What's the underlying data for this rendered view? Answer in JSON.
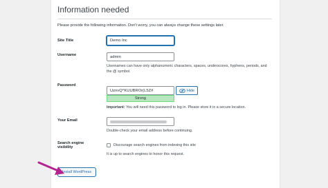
{
  "page": {
    "heading": "Information needed",
    "intro": "Please provide the following information. Don't worry, you can always change these settings later."
  },
  "site_title": {
    "label": "Site Title",
    "value": "Demo Inc"
  },
  "username": {
    "label": "Username",
    "value": "admin",
    "help": "Usernames can have only alphanumeric characters, spaces, underscores, hyphens, periods, and the @ symbol."
  },
  "password": {
    "label": "Password",
    "value": "UznvQ^KUUBROr(L5Z#",
    "hide_label": "Hide",
    "strength": "Strong",
    "important_label": "Important:",
    "important_text": "You will need this password to log in. Please store it in a secure location."
  },
  "email": {
    "label": "Your Email",
    "help": "Double-check your email address before continuing."
  },
  "search_visibility": {
    "label_line1": "Search engine",
    "label_line2": "visibility",
    "checkbox_label": "Discourage search engines from indexing this site",
    "help": "It is up to search engines to honor this request.",
    "checked": false
  },
  "install_button": {
    "label": "Install WordPress"
  },
  "colors": {
    "accent": "#2271b1",
    "arrow": "#b4238f",
    "strength_bg": "#b8e6bf"
  },
  "icons": {
    "hide": "eye-slash-icon",
    "pointer": "arrow-icon"
  }
}
